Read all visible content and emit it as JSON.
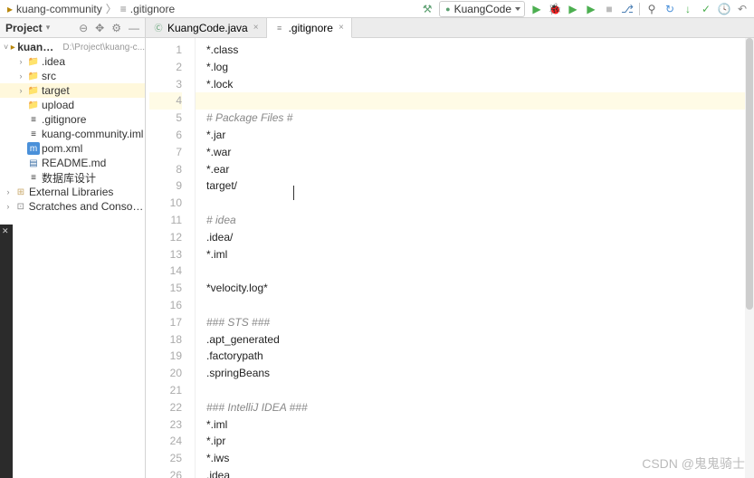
{
  "breadcrumb": {
    "project": "kuang-community",
    "file": ".gitignore"
  },
  "runConfig": {
    "label": "KuangCode"
  },
  "projectPanel": {
    "title": "Project",
    "root": {
      "name": "kuang-community",
      "hint": "D:\\Project\\kuang-c..."
    },
    "items": [
      {
        "name": ".idea",
        "indent": 1,
        "type": "folder",
        "arrow": "›"
      },
      {
        "name": "src",
        "indent": 1,
        "type": "src",
        "arrow": "›"
      },
      {
        "name": "target",
        "indent": 1,
        "type": "folder",
        "arrow": "›",
        "sel": true
      },
      {
        "name": "upload",
        "indent": 1,
        "type": "folder",
        "arrow": ""
      },
      {
        "name": ".gitignore",
        "indent": 1,
        "type": "git",
        "arrow": ""
      },
      {
        "name": "kuang-community.iml",
        "indent": 1,
        "type": "iml",
        "arrow": ""
      },
      {
        "name": "pom.xml",
        "indent": 1,
        "type": "xml",
        "arrow": ""
      },
      {
        "name": "README.md",
        "indent": 1,
        "type": "md",
        "arrow": ""
      },
      {
        "name": "数据库设计",
        "indent": 1,
        "type": "file",
        "arrow": ""
      }
    ],
    "external": "External Libraries",
    "scratches": "Scratches and Consoles"
  },
  "tabs": [
    {
      "label": "KuangCode.java",
      "active": false,
      "icon": "java"
    },
    {
      "label": ".gitignore",
      "active": true,
      "icon": "git"
    }
  ],
  "editor": {
    "lines": [
      {
        "n": 1,
        "t": "*.class"
      },
      {
        "n": 2,
        "t": "*.log"
      },
      {
        "n": 3,
        "t": "*.lock"
      },
      {
        "n": 4,
        "t": "",
        "hl": true
      },
      {
        "n": 5,
        "t": "# Package Files #",
        "c": true
      },
      {
        "n": 6,
        "t": "*.jar"
      },
      {
        "n": 7,
        "t": "*.war"
      },
      {
        "n": 8,
        "t": "*.ear"
      },
      {
        "n": 9,
        "t": "target/"
      },
      {
        "n": 10,
        "t": ""
      },
      {
        "n": 11,
        "t": "# idea",
        "c": true
      },
      {
        "n": 12,
        "t": ".idea/"
      },
      {
        "n": 13,
        "t": "*.iml"
      },
      {
        "n": 14,
        "t": ""
      },
      {
        "n": 15,
        "t": "*velocity.log*"
      },
      {
        "n": 16,
        "t": ""
      },
      {
        "n": 17,
        "t": "### STS ###",
        "c": true
      },
      {
        "n": 18,
        "t": ".apt_generated"
      },
      {
        "n": 19,
        "t": ".factorypath"
      },
      {
        "n": 20,
        "t": ".springBeans"
      },
      {
        "n": 21,
        "t": ""
      },
      {
        "n": 22,
        "t": "### IntelliJ IDEA ###",
        "c": true
      },
      {
        "n": 23,
        "t": "*.iml"
      },
      {
        "n": 24,
        "t": "*.ipr"
      },
      {
        "n": 25,
        "t": "*.iws"
      },
      {
        "n": 26,
        "t": ".idea"
      }
    ]
  },
  "watermark": "CSDN @鬼鬼骑士"
}
